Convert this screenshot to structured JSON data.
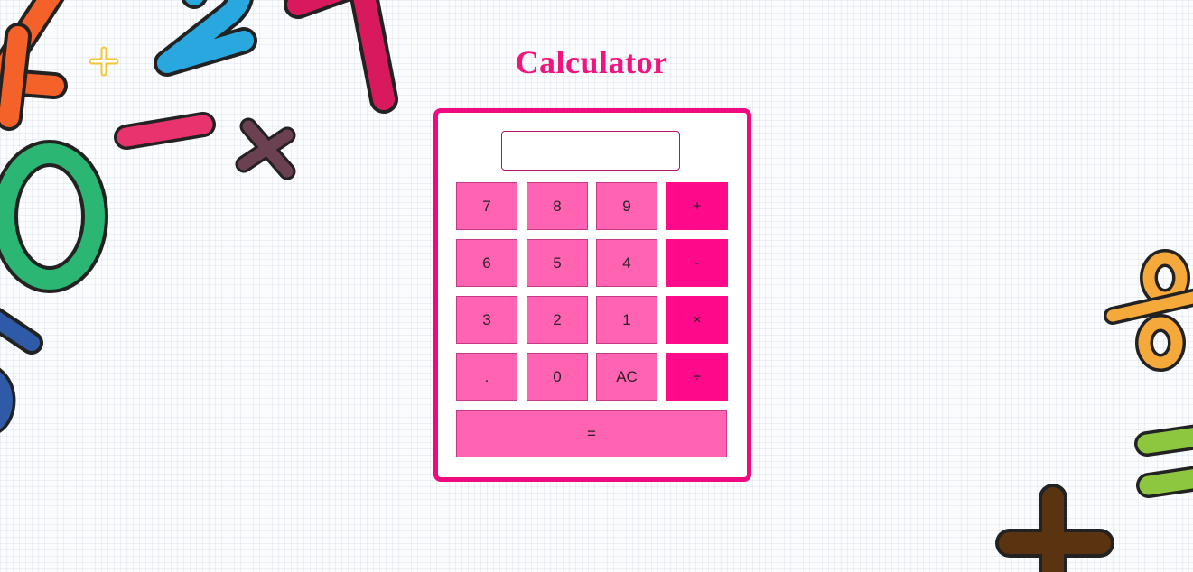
{
  "page": {
    "title": "Calculator",
    "accent_color": "#f0157e",
    "key_color": "#ff63b1",
    "operator_color": "#ff0a8a"
  },
  "calculator": {
    "display_value": "",
    "rows": [
      [
        "7",
        "8",
        "9",
        "+"
      ],
      [
        "6",
        "5",
        "4",
        "-"
      ],
      [
        "3",
        "2",
        "1",
        "×"
      ],
      [
        ".",
        "0",
        "AC",
        "÷"
      ]
    ],
    "equals_label": "="
  },
  "decorations": {
    "items": [
      "digit-4",
      "digit-2",
      "digit-1",
      "digit-0",
      "minus",
      "multiply",
      "plus-small",
      "percent",
      "equals",
      "plus-large",
      "digit-7"
    ]
  }
}
